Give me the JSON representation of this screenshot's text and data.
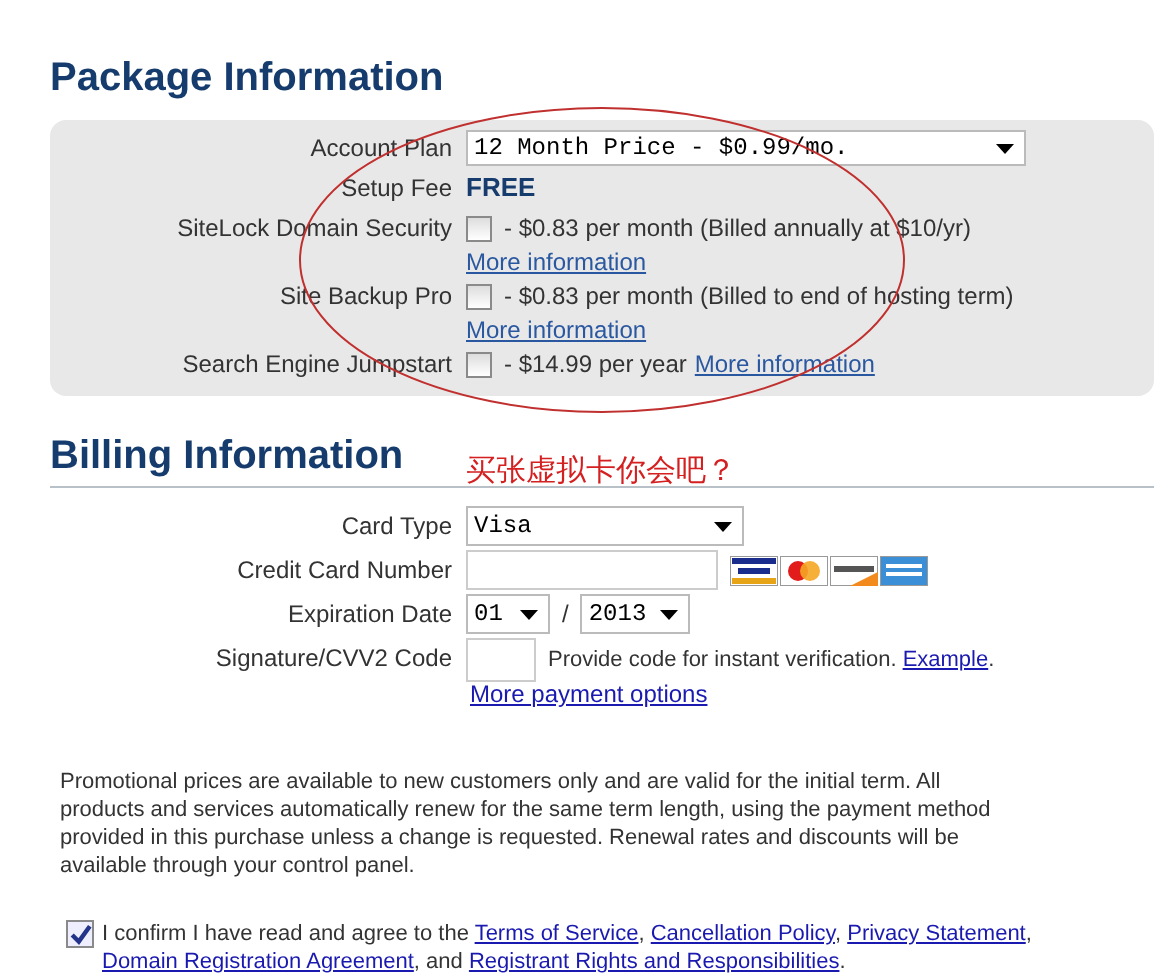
{
  "package": {
    "title": "Package Information",
    "rows": [
      {
        "kind": "select",
        "label": "Account Plan",
        "value": "12 Month Price - $0.99/mo."
      },
      {
        "kind": "value",
        "label": "Setup Fee",
        "value": "FREE"
      },
      {
        "kind": "addon",
        "label": "SiteLock Domain Security",
        "checked": false,
        "description": "- $0.83 per month (Billed annually at $10/yr)",
        "link": "More information"
      },
      {
        "kind": "addon",
        "label": "Site Backup Pro",
        "checked": false,
        "description": "- $0.83 per month (Billed to end of hosting term)",
        "link": "More information"
      },
      {
        "kind": "addon_inline",
        "label": "Search Engine Jumpstart",
        "checked": false,
        "description": "- $14.99 per year",
        "link": "More information"
      }
    ]
  },
  "annotation": "买张虚拟卡你会吧？",
  "billing": {
    "title": "Billing Information",
    "rows": [
      {
        "kind": "select",
        "label": "Card Type",
        "value": "Visa"
      },
      {
        "kind": "card",
        "label": "Credit Card Number"
      },
      {
        "kind": "date",
        "label": "Expiration Date",
        "month": "01",
        "separator": "/",
        "year": "2013"
      },
      {
        "kind": "cvv",
        "label": "Signature/CVV2 Code",
        "hint": "Provide code for instant verification.",
        "link": "Example",
        "suffix": "."
      }
    ],
    "more_link": "More payment options"
  },
  "promo": "Promotional prices are available to new customers only and are valid for the initial term. All products and services automatically renew for the same term length, using the payment method provided in this purchase unless a change is requested. Renewal rates and discounts will be available through your control panel.",
  "confirm": {
    "checked": true,
    "parts": [
      {
        "kind": "text",
        "text": "I confirm I have read and agree to the"
      },
      {
        "kind": "link",
        "text": "Terms of Service"
      },
      {
        "kind": "text",
        "text": ","
      },
      {
        "kind": "link",
        "text": "Cancellation Policy"
      },
      {
        "kind": "text",
        "text": ","
      },
      {
        "kind": "link",
        "text": "Privacy Statement"
      },
      {
        "kind": "text",
        "text": ","
      },
      {
        "kind": "link",
        "text": "Domain Registration Agreement"
      },
      {
        "kind": "text",
        "text": ", and"
      },
      {
        "kind": "link",
        "text": "Registrant Rights and Responsibilities"
      },
      {
        "kind": "text",
        "text": "."
      }
    ]
  }
}
